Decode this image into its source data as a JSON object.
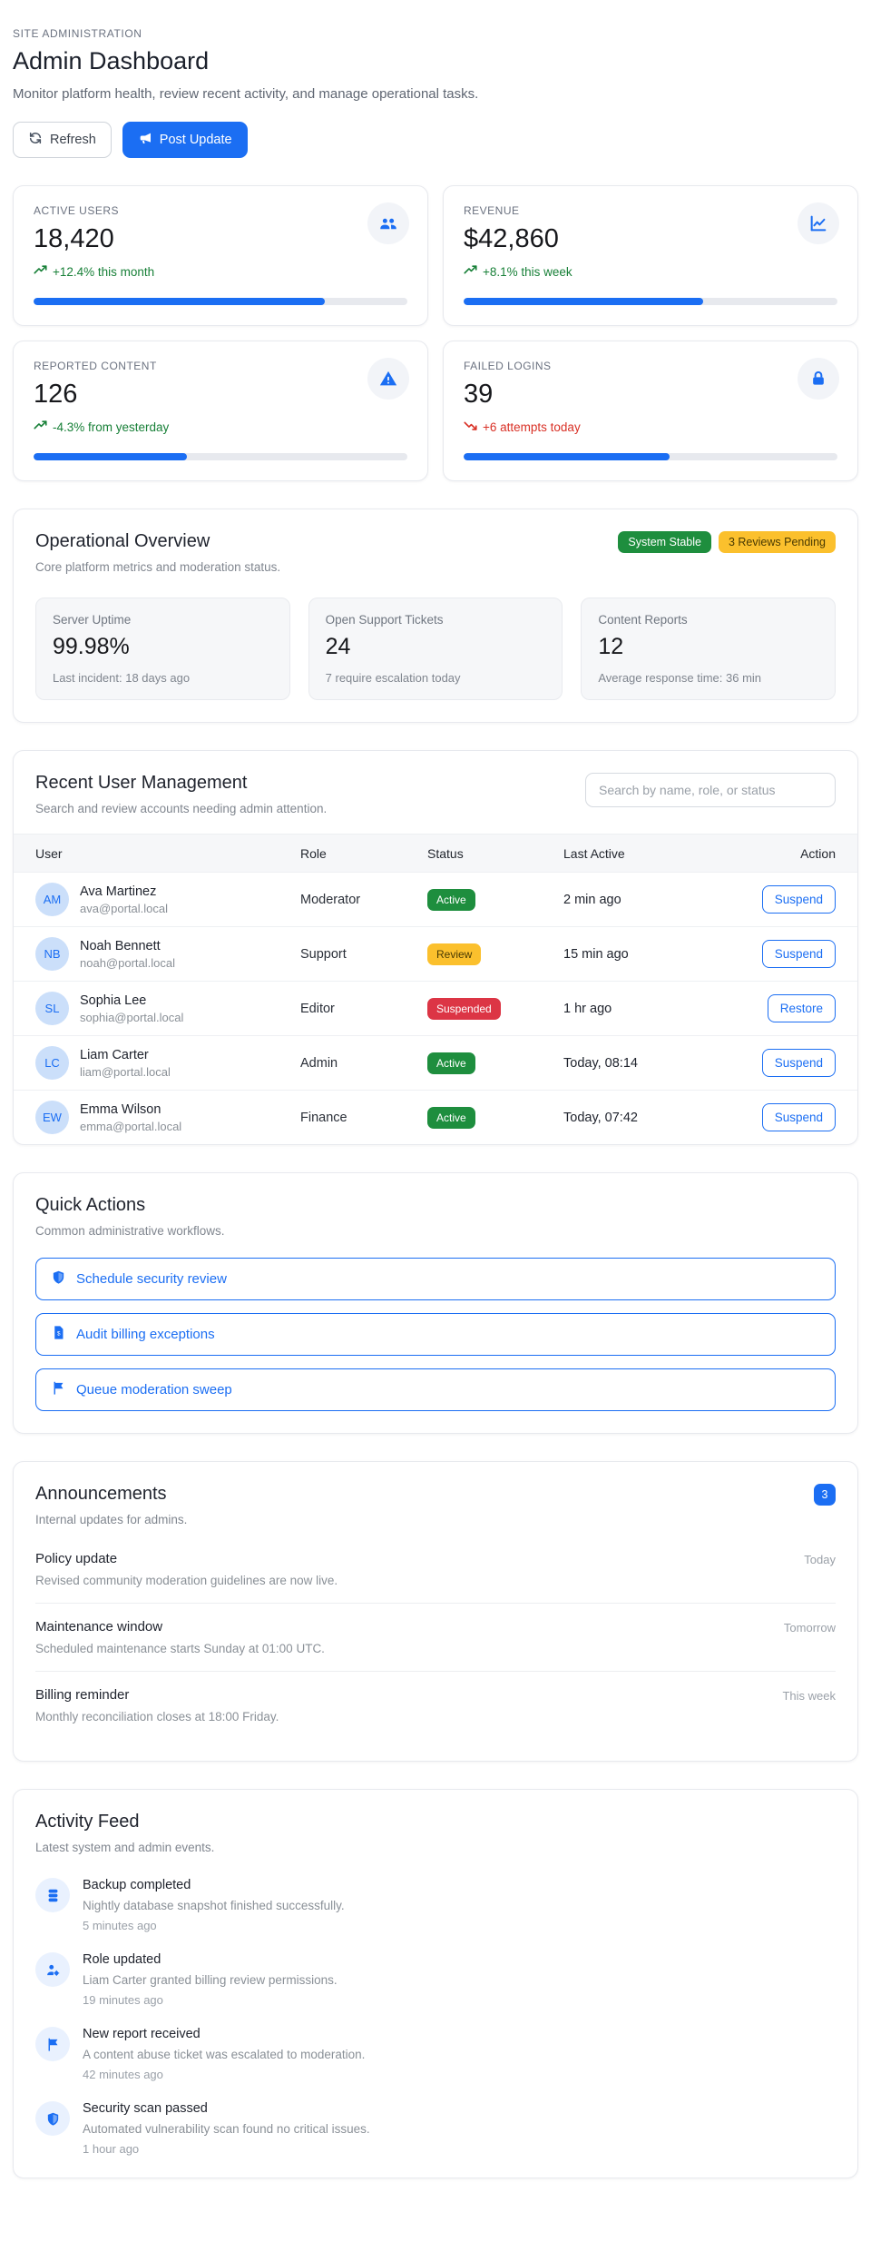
{
  "header": {
    "eyebrow": "SITE ADMINISTRATION",
    "title": "Admin Dashboard",
    "subtitle": "Monitor platform health, review recent activity, and manage operational tasks.",
    "refresh_label": "Refresh",
    "post_update_label": "Post Update"
  },
  "colors": {
    "accent": "#1b6ef3",
    "green": "#1e8e3e",
    "yellow": "#fbc02d",
    "red": "#dc3545",
    "trend_green": "#188038",
    "trend_red": "#d93025"
  },
  "stat_cards": [
    {
      "label": "ACTIVE USERS",
      "value": "18,420",
      "trend": "+12.4% this month",
      "trend_direction": "up",
      "icon": "users-icon",
      "progress": 78
    },
    {
      "label": "REVENUE",
      "value": "$42,860",
      "trend": "+8.1% this week",
      "trend_direction": "up",
      "icon": "line-chart-icon",
      "progress": 64
    },
    {
      "label": "REPORTED CONTENT",
      "value": "126",
      "trend": "-4.3% from yesterday",
      "trend_direction": "up",
      "icon": "alert-triangle-icon",
      "progress": 41
    },
    {
      "label": "FAILED LOGINS",
      "value": "39",
      "trend": "+6 attempts today",
      "trend_direction": "down",
      "icon": "lock-icon",
      "progress": 55
    }
  ],
  "operational": {
    "title": "Operational Overview",
    "subtitle": "Core platform metrics and moderation status.",
    "badges": [
      {
        "label": "System Stable",
        "tone": "green"
      },
      {
        "label": "3 Reviews Pending",
        "tone": "yellow"
      }
    ],
    "metrics": [
      {
        "label": "Server Uptime",
        "value": "99.98%",
        "note": "Last incident: 18 days ago"
      },
      {
        "label": "Open Support Tickets",
        "value": "24",
        "note": "7 require escalation today"
      },
      {
        "label": "Content Reports",
        "value": "12",
        "note": "Average response time: 36 min"
      }
    ]
  },
  "user_management": {
    "title": "Recent User Management",
    "subtitle": "Search and review accounts needing admin attention.",
    "search_placeholder": "Search by name, role, or status",
    "columns": [
      "User",
      "Role",
      "Status",
      "Last Active",
      "Action"
    ],
    "rows": [
      {
        "initials": "AM",
        "name": "Ava Martinez",
        "email": "ava@portal.local",
        "role": "Moderator",
        "status": "Active",
        "last_active": "2 min ago",
        "action": "Suspend"
      },
      {
        "initials": "NB",
        "name": "Noah Bennett",
        "email": "noah@portal.local",
        "role": "Support",
        "status": "Review",
        "last_active": "15 min ago",
        "action": "Suspend"
      },
      {
        "initials": "SL",
        "name": "Sophia Lee",
        "email": "sophia@portal.local",
        "role": "Editor",
        "status": "Suspended",
        "last_active": "1 hr ago",
        "action": "Restore"
      },
      {
        "initials": "LC",
        "name": "Liam Carter",
        "email": "liam@portal.local",
        "role": "Admin",
        "status": "Active",
        "last_active": "Today, 08:14",
        "action": "Suspend"
      },
      {
        "initials": "EW",
        "name": "Emma Wilson",
        "email": "emma@portal.local",
        "role": "Finance",
        "status": "Active",
        "last_active": "Today, 07:42",
        "action": "Suspend"
      }
    ]
  },
  "quick_actions": {
    "title": "Quick Actions",
    "subtitle": "Common administrative workflows.",
    "actions": [
      {
        "label": "Schedule security review",
        "icon": "shield-icon"
      },
      {
        "label": "Audit billing exceptions",
        "icon": "billing-file-icon"
      },
      {
        "label": "Queue moderation sweep",
        "icon": "flag-icon"
      }
    ]
  },
  "announcements": {
    "title": "Announcements",
    "subtitle": "Internal updates for admins.",
    "count_badge": "3",
    "items": [
      {
        "title": "Policy update",
        "description": "Revised community moderation guidelines are now live.",
        "when": "Today"
      },
      {
        "title": "Maintenance window",
        "description": "Scheduled maintenance starts Sunday at 01:00 UTC.",
        "when": "Tomorrow"
      },
      {
        "title": "Billing reminder",
        "description": "Monthly reconciliation closes at 18:00 Friday.",
        "when": "This week"
      }
    ]
  },
  "activity_feed": {
    "title": "Activity Feed",
    "subtitle": "Latest system and admin events.",
    "events": [
      {
        "title": "Backup completed",
        "description": "Nightly database snapshot finished successfully.",
        "time": "5 minutes ago",
        "icon": "database-icon"
      },
      {
        "title": "Role updated",
        "description": "Liam Carter granted billing review permissions.",
        "time": "19 minutes ago",
        "icon": "user-gear-icon"
      },
      {
        "title": "New report received",
        "description": "A content abuse ticket was escalated to moderation.",
        "time": "42 minutes ago",
        "icon": "flag-icon"
      },
      {
        "title": "Security scan passed",
        "description": "Automated vulnerability scan found no critical issues.",
        "time": "1 hour ago",
        "icon": "shield-icon"
      }
    ]
  }
}
